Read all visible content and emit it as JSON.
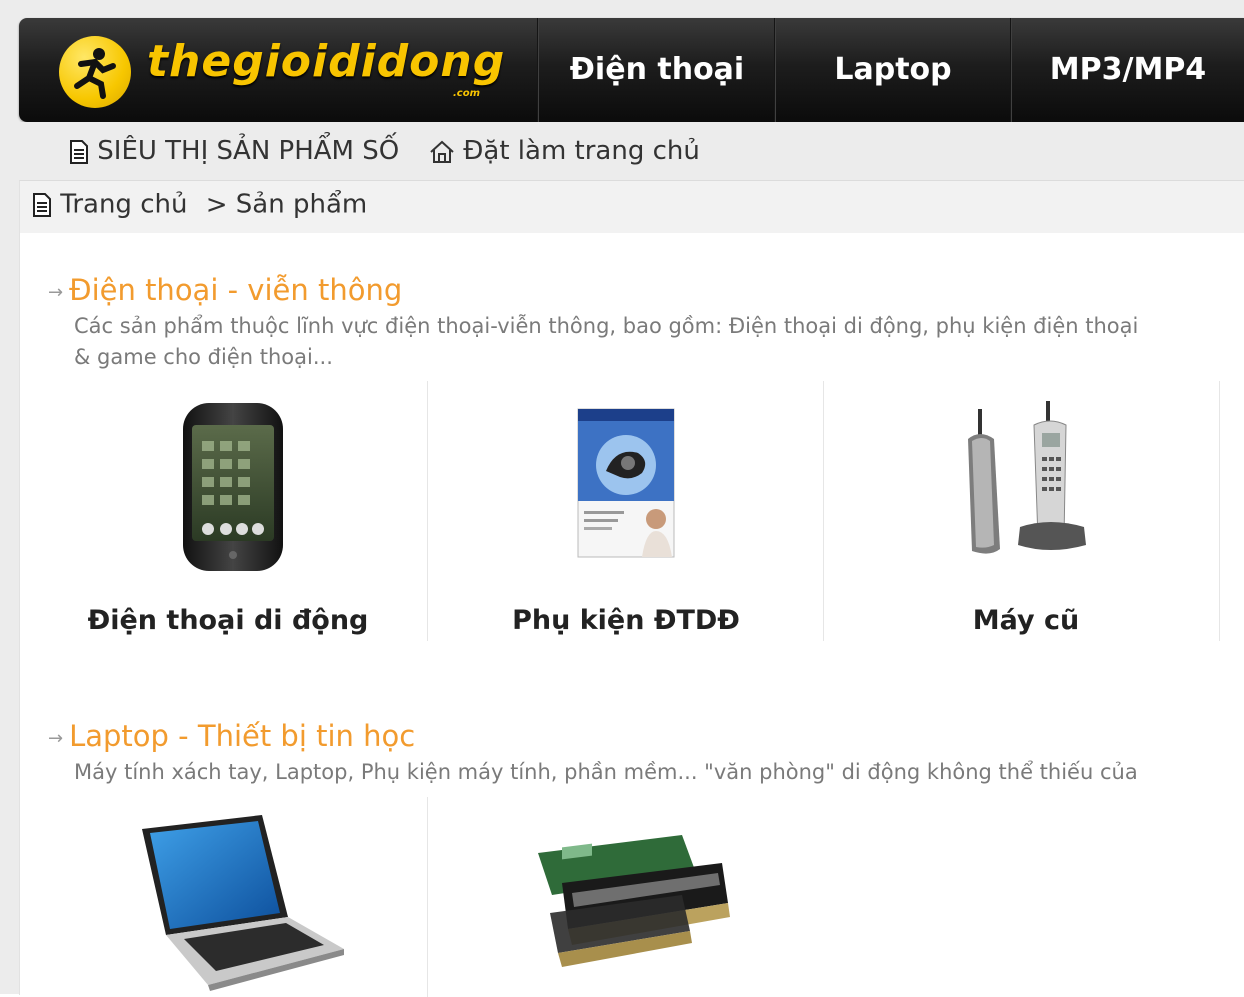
{
  "header": {
    "logo_text": "thegioididong",
    "logo_suffix": ".com",
    "nav_items": [
      "Điện thoại",
      "Laptop",
      "MP3/MP4"
    ]
  },
  "subbar": {
    "site_link": "SIÊU THỊ SẢN PHẨM SỐ",
    "home_link": "Đặt làm trang chủ"
  },
  "breadcrumb": {
    "home": "Trang chủ",
    "separator": ">",
    "current": "Sản phẩm"
  },
  "categories": [
    {
      "title": "Điện thoại - viễn thông",
      "description_line1": "Các sản phẩm thuộc lĩnh vực điện thoại-viễn thông, bao gồm: Điện thoại di động, phụ kiện điện thoại",
      "description_line2": "& game cho điện thoại...",
      "products": [
        "Điện thoại di động",
        "Phụ kiện ĐTDĐ",
        "Máy cũ"
      ]
    },
    {
      "title": "Laptop - Thiết bị tin học",
      "description_line1": "Máy tính xách tay, Laptop, Phụ kiện máy tính, phần mềm... \"văn phòng\" di động không thể thiếu của",
      "products": []
    }
  ],
  "colors": {
    "brand_yellow": "#f8c400",
    "category_orange": "#f29b2e",
    "nav_dark": "#1d1d1d"
  }
}
